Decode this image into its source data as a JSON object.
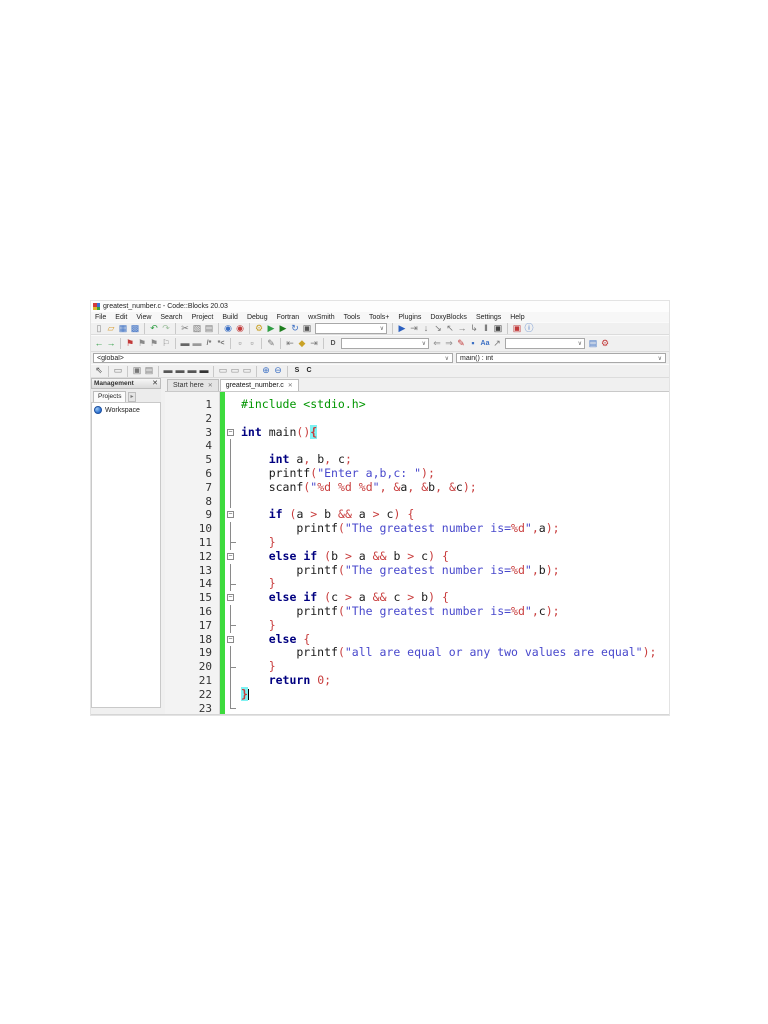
{
  "window": {
    "title": "greatest_number.c - Code::Blocks 20.03",
    "menu": [
      "File",
      "Edit",
      "View",
      "Search",
      "Project",
      "Build",
      "Debug",
      "Fortran",
      "wxSmith",
      "Tools",
      "Tools+",
      "Plugins",
      "DoxyBlocks",
      "Settings",
      "Help"
    ],
    "symbol_combos": {
      "scope": "<global>",
      "function": "main() : int"
    },
    "management": {
      "title": "Management",
      "close": "✕",
      "tab": "Projects",
      "tab_scroll": "▸",
      "workspace": "Workspace"
    },
    "tabs": [
      {
        "label": "Start here",
        "close": "✕",
        "active": false
      },
      {
        "label": "greatest_number.c",
        "close": "✕",
        "active": true
      }
    ]
  },
  "toolbar_main": [
    [
      {
        "n": "new-file-icon",
        "g": "▯",
        "c": "#8a8a8a"
      },
      {
        "n": "open-file-icon",
        "g": "▱",
        "c": "#d79b2e"
      },
      {
        "n": "save-file-icon",
        "g": "▦",
        "c": "#3b6fc4"
      },
      {
        "n": "save-all-icon",
        "g": "▩",
        "c": "#3b6fc4"
      }
    ],
    [
      {
        "n": "undo-icon",
        "g": "↶",
        "c": "#2f9e44"
      },
      {
        "n": "redo-icon",
        "g": "↷",
        "c": "#9dbf9d"
      }
    ],
    [
      {
        "n": "cut-icon",
        "g": "✂",
        "c": "#777777"
      },
      {
        "n": "copy-icon",
        "g": "▧",
        "c": "#777777"
      },
      {
        "n": "paste-icon",
        "g": "▤",
        "c": "#777777"
      }
    ],
    [
      {
        "n": "find-icon",
        "g": "◉",
        "c": "#3b6fc4"
      },
      {
        "n": "replace-icon",
        "g": "◉",
        "c": "#c23a3a"
      }
    ],
    [
      {
        "n": "build-icon",
        "g": "⚙",
        "c": "#c9a227"
      },
      {
        "n": "run-icon",
        "g": "▶",
        "c": "#2f9e44"
      },
      {
        "n": "build-and-run-icon",
        "g": "▶",
        "c": "#1e7e1e"
      },
      {
        "n": "rebuild-icon",
        "g": "↻",
        "c": "#3b6fc4"
      },
      {
        "n": "abort-build-icon",
        "g": "▣",
        "c": "#555555"
      }
    ]
  ],
  "toolbar_debug": [
    [
      {
        "n": "debug-continue-icon",
        "g": "▶",
        "c": "#2b5fbf"
      },
      {
        "n": "run-to-cursor-icon",
        "g": "⇥",
        "c": "#777777"
      },
      {
        "n": "next-line-icon",
        "g": "↓",
        "c": "#777777"
      },
      {
        "n": "step-into-icon",
        "g": "↘",
        "c": "#777777"
      },
      {
        "n": "step-out-icon",
        "g": "↖",
        "c": "#777777"
      },
      {
        "n": "next-instruction-icon",
        "g": "→",
        "c": "#777777"
      },
      {
        "n": "step-into-instruction-icon",
        "g": "↳",
        "c": "#777777"
      },
      {
        "n": "pause-debugger-icon",
        "g": "‖",
        "c": "#444444"
      },
      {
        "n": "stop-debugger-icon",
        "g": "▣",
        "c": "#444444"
      }
    ],
    [
      {
        "n": "debugging-windows-icon",
        "g": "▣",
        "c": "#c23a3a"
      },
      {
        "n": "various-info-icon",
        "g": "ⓘ",
        "c": "#3b6fc4"
      }
    ]
  ],
  "toolbar_nav_left": [
    [
      {
        "n": "nav-back-icon",
        "g": "←",
        "c": "#2f9e44"
      },
      {
        "n": "nav-forward-icon",
        "g": "→",
        "c": "#2f9e44"
      }
    ],
    [
      {
        "n": "toggle-bookmark-icon",
        "g": "⚑",
        "c": "#c23a3a"
      },
      {
        "n": "prev-bookmark-icon",
        "g": "⚑",
        "c": "#8a8a8a"
      },
      {
        "n": "next-bookmark-icon",
        "g": "⚑",
        "c": "#8a8a8a"
      },
      {
        "n": "clear-bookmarks-icon",
        "g": "⚐",
        "c": "#8a8a8a"
      }
    ],
    [
      {
        "n": "block-comment-icon",
        "g": "▬",
        "c": "#666666"
      },
      {
        "n": "uncomment-icon",
        "g": "▬",
        "c": "#999999"
      },
      {
        "n": "doxy-block-comment-icon",
        "g": "/*",
        "c": "#666666",
        "t": 1
      },
      {
        "n": "doxy-line-comment-icon",
        "g": "*<",
        "c": "#666666",
        "t": 1
      }
    ],
    [
      {
        "n": "insert-comment-icon",
        "g": "▫",
        "c": "#777777"
      },
      {
        "n": "doxy-help-icon",
        "g": "▫",
        "c": "#777777"
      }
    ],
    [
      {
        "n": "extract-docs-icon",
        "g": "✎",
        "c": "#777777"
      }
    ],
    [
      {
        "n": "jump-back-icon",
        "g": "⇤",
        "c": "#777777"
      },
      {
        "n": "jump-marker-icon",
        "g": "◆",
        "c": "#c9a227"
      },
      {
        "n": "jump-forward-icon",
        "g": "⇥",
        "c": "#777777"
      }
    ],
    [
      {
        "n": "doxyblocks-icon",
        "g": "D",
        "c": "#555555",
        "t": 1
      }
    ]
  ],
  "toolbar_nav_mid": [
    [
      {
        "n": "search-prev-icon",
        "g": "⇐",
        "c": "#8a8a8a"
      },
      {
        "n": "search-next-icon",
        "g": "⇒",
        "c": "#8a8a8a"
      },
      {
        "n": "highlight-all-icon",
        "g": "✎",
        "c": "#c23a3a"
      },
      {
        "n": "selected-only-icon",
        "g": "▪",
        "c": "#3b6fc4"
      },
      {
        "n": "match-case-icon",
        "g": "Aa",
        "c": "#3b6fc4",
        "t": 1
      },
      {
        "n": "regex-search-icon",
        "g": "↗",
        "c": "#777777"
      }
    ]
  ],
  "toolbar_nav_right": [
    [
      {
        "n": "find-in-files-icon",
        "g": "▤",
        "c": "#3b6fc4"
      },
      {
        "n": "search-options-icon",
        "g": "⚙",
        "c": "#c23a3a"
      }
    ]
  ],
  "toolbar_view": [
    [
      {
        "n": "pointer-tool-icon",
        "g": "⇖",
        "c": "#444444"
      }
    ],
    [
      {
        "n": "frame-tool-icon",
        "g": "▭",
        "c": "#777777"
      }
    ],
    [
      {
        "n": "image-tool-icon",
        "g": "▣",
        "c": "#777777"
      },
      {
        "n": "image-text-tool-icon",
        "g": "▤",
        "c": "#777777"
      }
    ],
    [
      {
        "n": "bar-tool-1-icon",
        "g": "▬",
        "c": "#555555"
      },
      {
        "n": "bar-tool-2-icon",
        "g": "▬",
        "c": "#555555"
      },
      {
        "n": "bar-tool-3-icon",
        "g": "▬",
        "c": "#555555"
      },
      {
        "n": "bar-tool-4-icon",
        "g": "▬",
        "c": "#333333"
      }
    ],
    [
      {
        "n": "shape-tool-1-icon",
        "g": "▭",
        "c": "#888888"
      },
      {
        "n": "shape-tool-2-icon",
        "g": "▭",
        "c": "#888888"
      },
      {
        "n": "shape-tool-3-icon",
        "g": "▭",
        "c": "#888888"
      }
    ],
    [
      {
        "n": "zoom-in-icon",
        "g": "⊕",
        "c": "#3b6fc4"
      },
      {
        "n": "zoom-out-icon",
        "g": "⊖",
        "c": "#3b6fc4"
      }
    ],
    [
      {
        "n": "s-tool-icon",
        "g": "S",
        "c": "#222222",
        "t": 1
      },
      {
        "n": "c-tool-icon",
        "g": "C",
        "c": "#222222",
        "t": 1
      }
    ]
  ],
  "editor": {
    "lines": [
      {
        "n": 1,
        "fold": "",
        "segs": [
          [
            "tp",
            "#include <stdio.h>"
          ]
        ]
      },
      {
        "n": 2,
        "fold": "",
        "segs": []
      },
      {
        "n": 3,
        "fold": "box",
        "segs": [
          [
            "tk",
            "int"
          ],
          [
            "ti",
            " main"
          ],
          [
            "to",
            "()"
          ],
          [
            "th",
            "{"
          ]
        ]
      },
      {
        "n": 4,
        "fold": "line",
        "segs": []
      },
      {
        "n": 5,
        "fold": "line",
        "segs": [
          [
            "ti",
            "    "
          ],
          [
            "tk",
            "int"
          ],
          [
            "ti",
            " a"
          ],
          [
            "to",
            ","
          ],
          [
            "ti",
            " b"
          ],
          [
            "to",
            ","
          ],
          [
            "ti",
            " c"
          ],
          [
            "to",
            ";"
          ]
        ]
      },
      {
        "n": 6,
        "fold": "line",
        "segs": [
          [
            "ti",
            "    printf"
          ],
          [
            "to",
            "("
          ],
          [
            "ts",
            "\"Enter a,b,c: \""
          ],
          [
            "to",
            ");"
          ]
        ]
      },
      {
        "n": 7,
        "fold": "line",
        "segs": [
          [
            "ti",
            "    scanf"
          ],
          [
            "to",
            "("
          ],
          [
            "ts",
            "\""
          ],
          [
            "tf",
            "%d"
          ],
          [
            "ts",
            " "
          ],
          [
            "tf",
            "%d"
          ],
          [
            "ts",
            " "
          ],
          [
            "tf",
            "%d"
          ],
          [
            "ts",
            "\""
          ],
          [
            "to",
            ","
          ],
          [
            "ti",
            " "
          ],
          [
            "to",
            "&"
          ],
          [
            "ti",
            "a"
          ],
          [
            "to",
            ","
          ],
          [
            "ti",
            " "
          ],
          [
            "to",
            "&"
          ],
          [
            "ti",
            "b"
          ],
          [
            "to",
            ","
          ],
          [
            "ti",
            " "
          ],
          [
            "to",
            "&"
          ],
          [
            "ti",
            "c"
          ],
          [
            "to",
            ");"
          ]
        ]
      },
      {
        "n": 8,
        "fold": "line",
        "segs": []
      },
      {
        "n": 9,
        "fold": "box",
        "segs": [
          [
            "ti",
            "    "
          ],
          [
            "tk",
            "if"
          ],
          [
            "ti",
            " "
          ],
          [
            "to",
            "("
          ],
          [
            "ti",
            "a "
          ],
          [
            "to",
            ">"
          ],
          [
            "ti",
            " b "
          ],
          [
            "to",
            "&&"
          ],
          [
            "ti",
            " a "
          ],
          [
            "to",
            ">"
          ],
          [
            "ti",
            " c"
          ],
          [
            "to",
            ")"
          ],
          [
            "ti",
            " "
          ],
          [
            "to",
            "{"
          ]
        ]
      },
      {
        "n": 10,
        "fold": "line",
        "segs": [
          [
            "ti",
            "        printf"
          ],
          [
            "to",
            "("
          ],
          [
            "ts",
            "\"The greatest number is="
          ],
          [
            "tf",
            "%d"
          ],
          [
            "ts",
            "\""
          ],
          [
            "to",
            ","
          ],
          [
            "ti",
            "a"
          ],
          [
            "to",
            ");"
          ]
        ]
      },
      {
        "n": 11,
        "fold": "tick",
        "segs": [
          [
            "ti",
            "    "
          ],
          [
            "to",
            "}"
          ]
        ]
      },
      {
        "n": 12,
        "fold": "box",
        "segs": [
          [
            "ti",
            "    "
          ],
          [
            "tk",
            "else"
          ],
          [
            "ti",
            " "
          ],
          [
            "tk",
            "if"
          ],
          [
            "ti",
            " "
          ],
          [
            "to",
            "("
          ],
          [
            "ti",
            "b "
          ],
          [
            "to",
            ">"
          ],
          [
            "ti",
            " a "
          ],
          [
            "to",
            "&&"
          ],
          [
            "ti",
            " b "
          ],
          [
            "to",
            ">"
          ],
          [
            "ti",
            " c"
          ],
          [
            "to",
            ")"
          ],
          [
            "ti",
            " "
          ],
          [
            "to",
            "{"
          ]
        ]
      },
      {
        "n": 13,
        "fold": "line",
        "segs": [
          [
            "ti",
            "        printf"
          ],
          [
            "to",
            "("
          ],
          [
            "ts",
            "\"The greatest number is="
          ],
          [
            "tf",
            "%d"
          ],
          [
            "ts",
            "\""
          ],
          [
            "to",
            ","
          ],
          [
            "ti",
            "b"
          ],
          [
            "to",
            ");"
          ]
        ]
      },
      {
        "n": 14,
        "fold": "tick",
        "segs": [
          [
            "ti",
            "    "
          ],
          [
            "to",
            "}"
          ]
        ]
      },
      {
        "n": 15,
        "fold": "box",
        "segs": [
          [
            "ti",
            "    "
          ],
          [
            "tk",
            "else"
          ],
          [
            "ti",
            " "
          ],
          [
            "tk",
            "if"
          ],
          [
            "ti",
            " "
          ],
          [
            "to",
            "("
          ],
          [
            "ti",
            "c "
          ],
          [
            "to",
            ">"
          ],
          [
            "ti",
            " a "
          ],
          [
            "to",
            "&&"
          ],
          [
            "ti",
            " c "
          ],
          [
            "to",
            ">"
          ],
          [
            "ti",
            " b"
          ],
          [
            "to",
            ")"
          ],
          [
            "ti",
            " "
          ],
          [
            "to",
            "{"
          ]
        ]
      },
      {
        "n": 16,
        "fold": "line",
        "segs": [
          [
            "ti",
            "        printf"
          ],
          [
            "to",
            "("
          ],
          [
            "ts",
            "\"The greatest number is="
          ],
          [
            "tf",
            "%d"
          ],
          [
            "ts",
            "\""
          ],
          [
            "to",
            ","
          ],
          [
            "ti",
            "c"
          ],
          [
            "to",
            ");"
          ]
        ]
      },
      {
        "n": 17,
        "fold": "tick",
        "segs": [
          [
            "ti",
            "    "
          ],
          [
            "to",
            "}"
          ]
        ]
      },
      {
        "n": 18,
        "fold": "box",
        "segs": [
          [
            "ti",
            "    "
          ],
          [
            "tk",
            "else"
          ],
          [
            "ti",
            " "
          ],
          [
            "to",
            "{"
          ]
        ]
      },
      {
        "n": 19,
        "fold": "line",
        "segs": [
          [
            "ti",
            "        printf"
          ],
          [
            "to",
            "("
          ],
          [
            "ts",
            "\"all are equal or any two values are equal\""
          ],
          [
            "to",
            ");"
          ]
        ]
      },
      {
        "n": 20,
        "fold": "tick",
        "segs": [
          [
            "ti",
            "    "
          ],
          [
            "to",
            "}"
          ]
        ]
      },
      {
        "n": 21,
        "fold": "line",
        "segs": [
          [
            "ti",
            "    "
          ],
          [
            "tk",
            "return"
          ],
          [
            "ti",
            " "
          ],
          [
            "tn",
            "0"
          ],
          [
            "to",
            ";"
          ]
        ]
      },
      {
        "n": 22,
        "fold": "line",
        "segs": [
          [
            "th",
            "}"
          ],
          [
            "caret",
            ""
          ]
        ]
      },
      {
        "n": 23,
        "fold": "end",
        "segs": []
      }
    ]
  },
  "colors": {
    "keyword": "#000080",
    "operator": "#c83c3c",
    "string": "#4848cc",
    "format": "#c83c3c",
    "preprocessor": "#009600",
    "number": "#c83c3c",
    "brace_highlight_bg": "#7ff2f2",
    "change_bar": "#3ddb3d",
    "toolbar_bg": "#f0f0f0"
  }
}
